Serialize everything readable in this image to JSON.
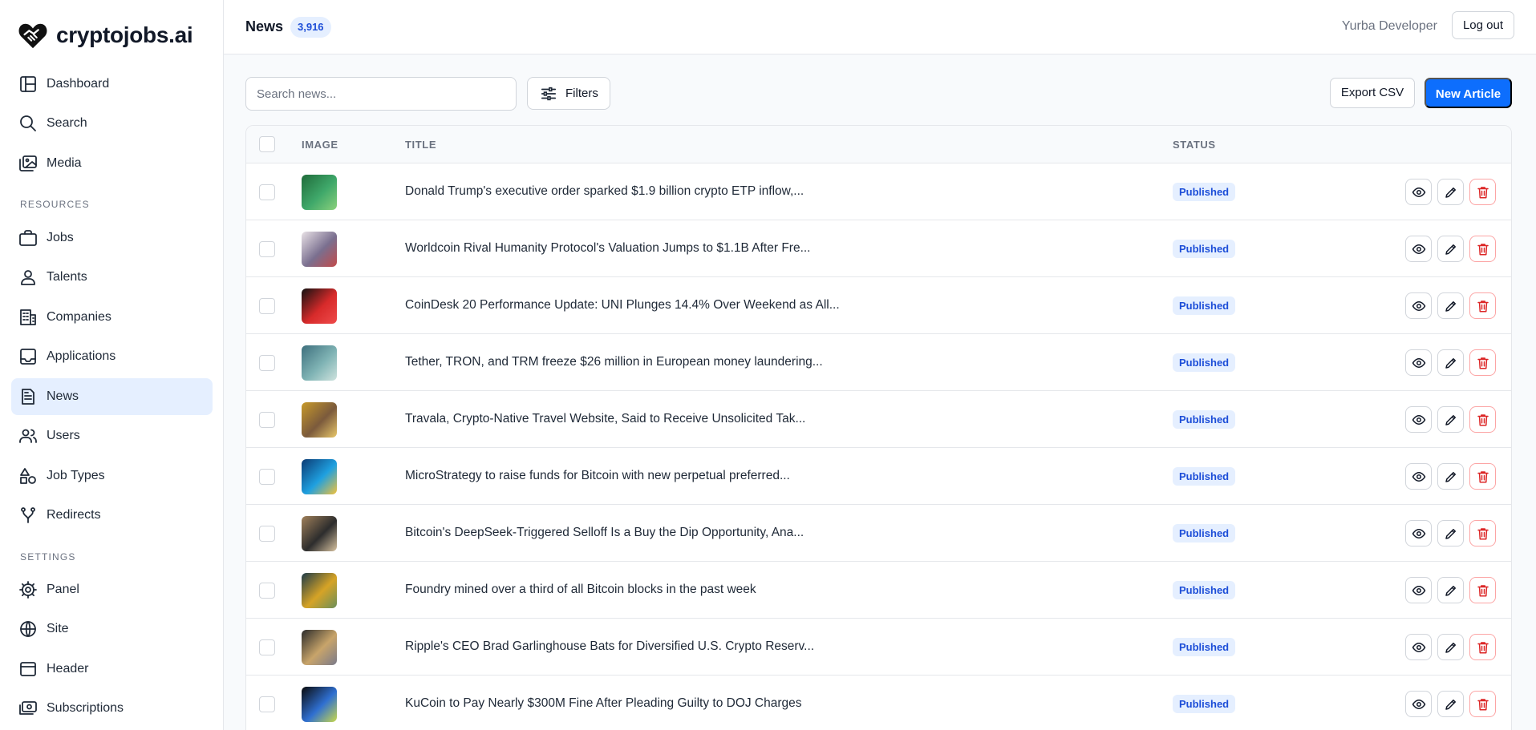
{
  "brand": {
    "name": "cryptojobs.ai"
  },
  "sidebar": {
    "main_items": [
      {
        "label": "Dashboard",
        "icon": "layout-icon"
      },
      {
        "label": "Search",
        "icon": "search-icon"
      },
      {
        "label": "Media",
        "icon": "images-icon"
      }
    ],
    "resources_label": "RESOURCES",
    "resource_items": [
      {
        "label": "Jobs",
        "icon": "briefcase-icon"
      },
      {
        "label": "Talents",
        "icon": "user-icon"
      },
      {
        "label": "Companies",
        "icon": "building-icon"
      },
      {
        "label": "Applications",
        "icon": "inbox-icon"
      },
      {
        "label": "News",
        "icon": "newspaper-icon",
        "active": true
      },
      {
        "label": "Users",
        "icon": "users-icon"
      },
      {
        "label": "Job Types",
        "icon": "shapes-icon"
      },
      {
        "label": "Redirects",
        "icon": "git-merge-icon"
      }
    ],
    "settings_label": "SETTINGS",
    "settings_items": [
      {
        "label": "Panel",
        "icon": "gear-icon"
      },
      {
        "label": "Site",
        "icon": "globe-icon"
      },
      {
        "label": "Header",
        "icon": "window-icon"
      },
      {
        "label": "Subscriptions",
        "icon": "money-icon"
      }
    ]
  },
  "header": {
    "title": "News",
    "count": "3,916",
    "user_name": "Yurba Developer",
    "logout_label": "Log out"
  },
  "toolbar": {
    "search_placeholder": "Search news...",
    "filters_label": "Filters",
    "export_label": "Export CSV",
    "new_label": "New Article"
  },
  "table": {
    "columns": {
      "image": "IMAGE",
      "title": "TITLE",
      "status": "STATUS"
    },
    "rows": [
      {
        "title": "Donald Trump's executive order sparked $1.9 billion crypto ETP inflow,...",
        "status": "Published",
        "thumb": [
          "#1f6b3a",
          "#3fa86a",
          "#8bd17c"
        ]
      },
      {
        "title": "Worldcoin Rival Humanity Protocol's Valuation Jumps to $1.1B After Fre...",
        "status": "Published",
        "thumb": [
          "#e9e2e6",
          "#7a6f8f",
          "#c34a4a"
        ]
      },
      {
        "title": "CoinDesk 20 Performance Update: UNI Plunges 14.4% Over Weekend as All...",
        "status": "Published",
        "thumb": [
          "#111111",
          "#d72a2a",
          "#ef4b4b"
        ]
      },
      {
        "title": "Tether, TRON, and TRM freeze $26 million in European money laundering...",
        "status": "Published",
        "thumb": [
          "#3d6f7d",
          "#7fb3b4",
          "#cfe3de"
        ]
      },
      {
        "title": "Travala, Crypto-Native Travel Website, Said to Receive Unsolicited Tak...",
        "status": "Published",
        "thumb": [
          "#c89a2a",
          "#7b5a3c",
          "#e8c76a"
        ]
      },
      {
        "title": "MicroStrategy to raise funds for Bitcoin with new perpetual preferred...",
        "status": "Published",
        "thumb": [
          "#0b3a73",
          "#1fa0e0",
          "#f4c23a"
        ]
      },
      {
        "title": "Bitcoin's DeepSeek-Triggered Selloff Is a Buy the Dip Opportunity, Ana...",
        "status": "Published",
        "thumb": [
          "#a0805a",
          "#2d2d2d",
          "#d8c3a0"
        ]
      },
      {
        "title": "Foundry mined over a third of all Bitcoin blocks in the past week",
        "status": "Published",
        "thumb": [
          "#1d3b49",
          "#d6a326",
          "#6b8f5a"
        ]
      },
      {
        "title": "Ripple's CEO Brad Garlinghouse Bats for Diversified U.S. Crypto Reserv...",
        "status": "Published",
        "thumb": [
          "#2b2b2b",
          "#c8a46a",
          "#7a7a8a"
        ]
      },
      {
        "title": "KuCoin to Pay Nearly $300M Fine After Pleading Guilty to DOJ Charges",
        "status": "Published",
        "thumb": [
          "#0a0a0a",
          "#2f6fd1",
          "#c9d94a"
        ]
      }
    ]
  }
}
